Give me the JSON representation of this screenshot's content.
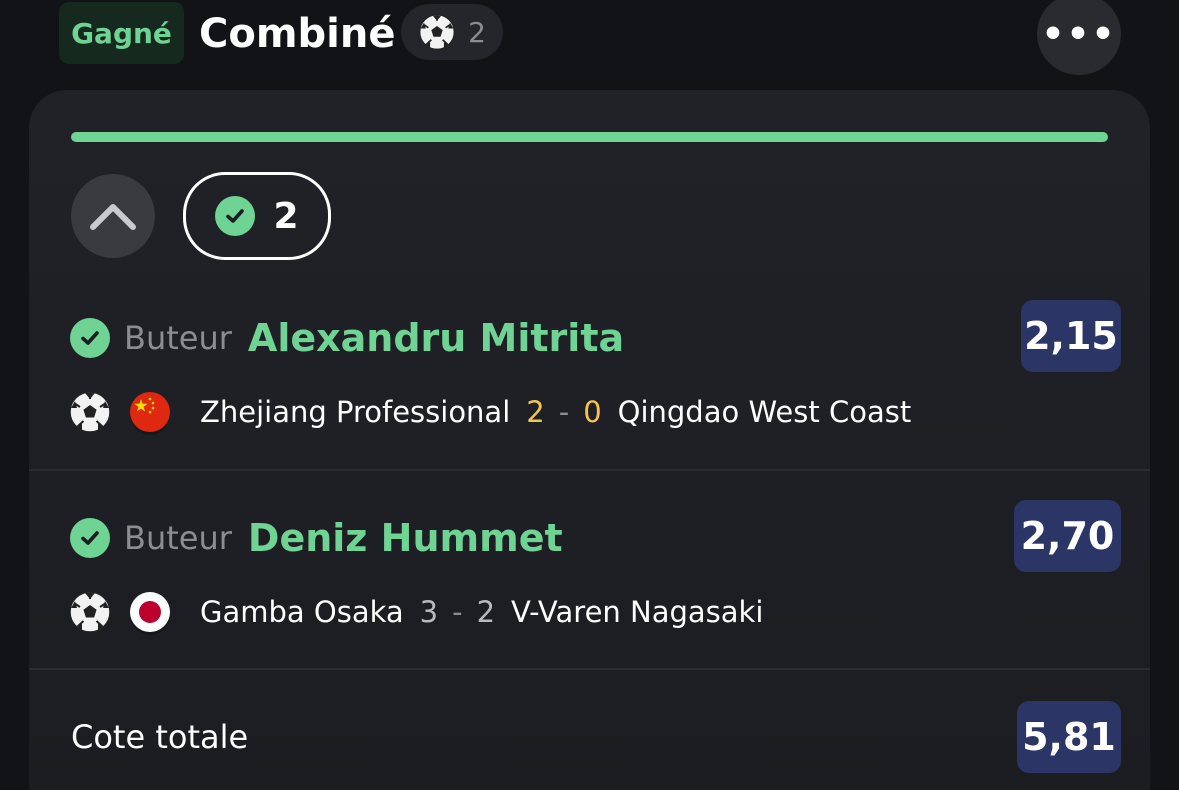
{
  "header": {
    "status": "Gagné",
    "title": "Combiné",
    "sport_count": "2",
    "more_label": "•••"
  },
  "progress": {
    "fraction": 1.0,
    "color": "#6fd394"
  },
  "legs_badge": {
    "count": "2"
  },
  "selections": [
    {
      "market": "Buteur",
      "player": "Alexandru Mitrita",
      "odds": "2,15",
      "home": "Zhejiang Professional",
      "home_score": "2",
      "separator": "-",
      "away_score": "0",
      "away": "Qingdao West Coast",
      "score_color": "#f4c54c",
      "flag": "china-flag-icon"
    },
    {
      "market": "Buteur",
      "player": "Deniz Hummet",
      "odds": "2,70",
      "home": "Gamba Osaka",
      "home_score": "3",
      "separator": "-",
      "away_score": "2",
      "away": "V-Varen Nagasaki",
      "score_color": "#b8bac0",
      "flag": "japan-flag-icon"
    }
  ],
  "total": {
    "label": "Cote totale",
    "odds": "5,81"
  },
  "colors": {
    "accent_green": "#6fd394",
    "odds_bg": "#2b3566",
    "background": "#121316"
  }
}
